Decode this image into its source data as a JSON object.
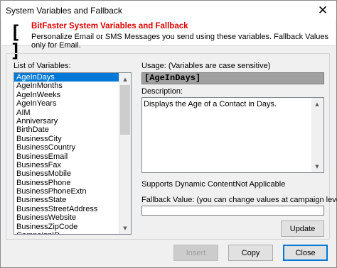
{
  "window": {
    "title": "System Variables and Fallback",
    "close_glyph": "✕"
  },
  "header": {
    "logo_text": "[ ]",
    "title": "BitFaster System Variables and Fallback",
    "subtitle": "Personalize Email or SMS Messages you send using these variables. Fallback Values only for Email."
  },
  "variables": {
    "label": "List of Variables:",
    "selected_index": 0,
    "items": [
      "AgeInDays",
      "AgeInMonths",
      "AgeInWeeks",
      "AgeInYears",
      "AIM",
      "Anniversary",
      "BirthDate",
      "BusinessCity",
      "BusinessCountry",
      "BusinessEmail",
      "BusinessFax",
      "BusinessMobile",
      "BusinessPhone",
      "BusinessPhoneExtn",
      "BusinessState",
      "BusinessStreetAddress",
      "BusinessWebsite",
      "BusinessZipCode",
      "CampaignID"
    ]
  },
  "usage": {
    "label": "Usage: (Variables are case sensitive)",
    "value": "[AgeInDays]"
  },
  "description": {
    "label": "Description:",
    "text": "Displays the Age of a Contact in Days."
  },
  "dynamic": {
    "label": "Supports Dynamic Content:",
    "value": "Not Applicable"
  },
  "fallback": {
    "label": "Fallback Value: (you can change values at campaign level)",
    "value": ""
  },
  "buttons": {
    "update": "Update",
    "insert": "Insert",
    "copy": "Copy",
    "close": "Close"
  },
  "colors": {
    "selection": "#0078d7",
    "header_title": "#e00000",
    "usage_background": "#a0a0a0"
  }
}
